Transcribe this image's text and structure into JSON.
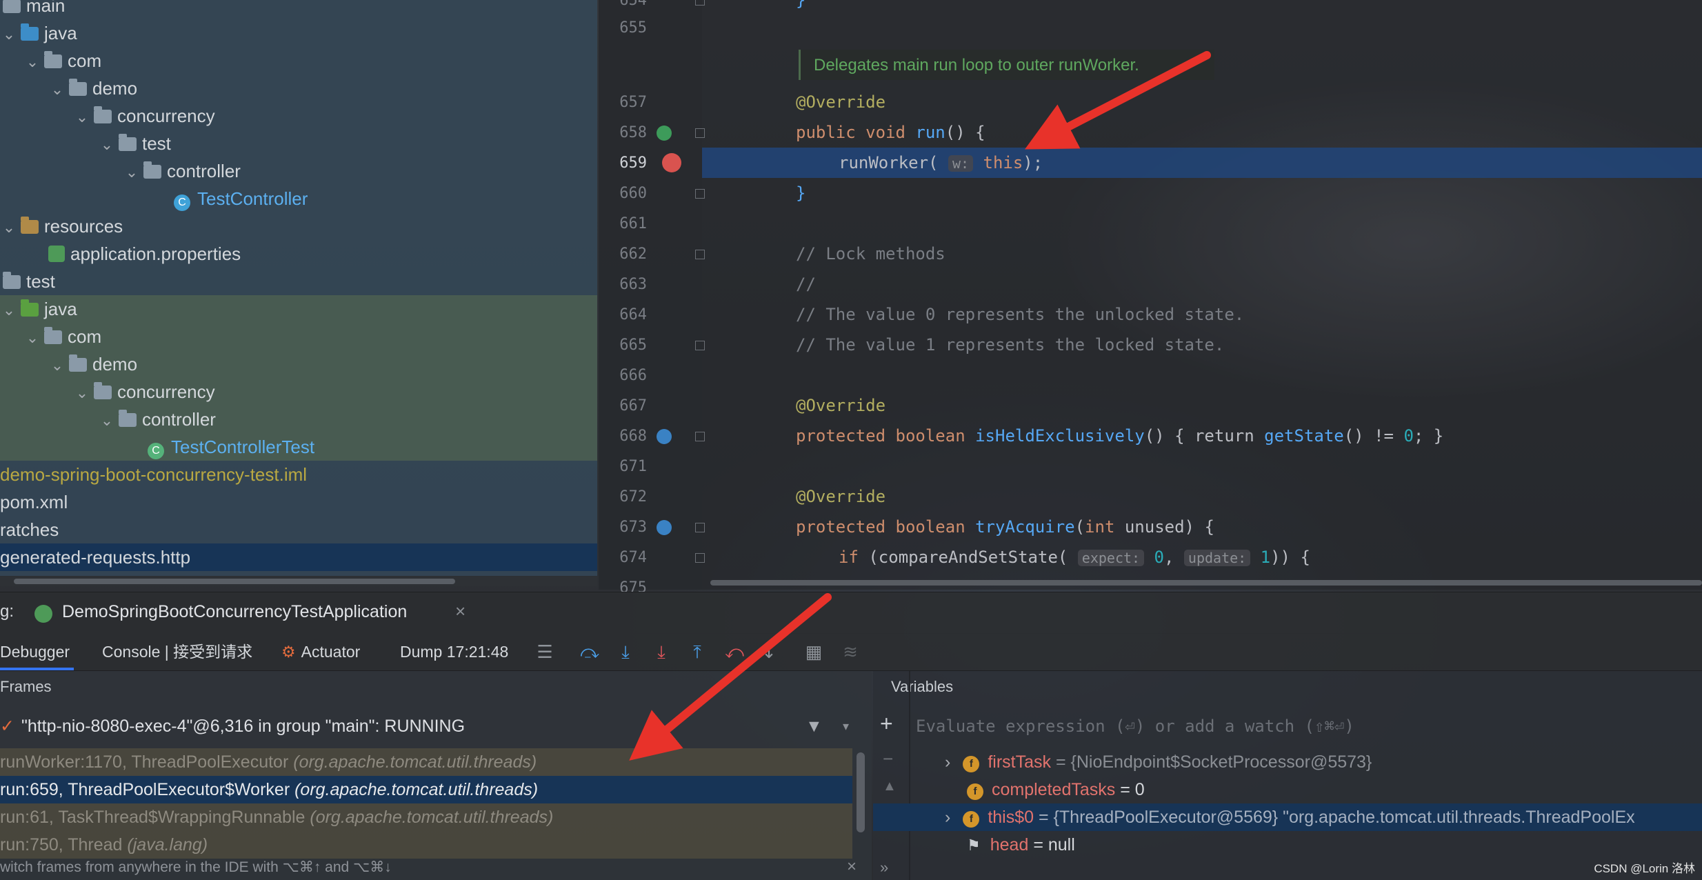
{
  "project_tree": {
    "items": [
      {
        "label": "main",
        "indent": 0,
        "kind": "folder"
      },
      {
        "label": "java",
        "indent": 1,
        "kind": "folder-blue"
      },
      {
        "label": "com",
        "indent": 2,
        "kind": "package"
      },
      {
        "label": "demo",
        "indent": 3,
        "kind": "package"
      },
      {
        "label": "concurrency",
        "indent": 4,
        "kind": "package"
      },
      {
        "label": "test",
        "indent": 5,
        "kind": "package"
      },
      {
        "label": "controller",
        "indent": 6,
        "kind": "package"
      },
      {
        "label": "TestController",
        "indent": 7,
        "kind": "class"
      },
      {
        "label": "resources",
        "indent": 1,
        "kind": "resources"
      },
      {
        "label": "application.properties",
        "indent": 2,
        "kind": "properties"
      },
      {
        "label": "test",
        "indent": 0,
        "kind": "folder"
      },
      {
        "label": "java",
        "indent": 1,
        "kind": "folder-green"
      },
      {
        "label": "com",
        "indent": 2,
        "kind": "package"
      },
      {
        "label": "demo",
        "indent": 3,
        "kind": "package"
      },
      {
        "label": "concurrency",
        "indent": 4,
        "kind": "package"
      },
      {
        "label": "controller",
        "indent": 5,
        "kind": "package"
      },
      {
        "label": "TestControllerTest",
        "indent": 6,
        "kind": "test-class"
      },
      {
        "label": "demo-spring-boot-concurrency-test.iml",
        "indent": 0,
        "kind": "iml"
      },
      {
        "label": "pom.xml",
        "indent": 0,
        "kind": "file"
      },
      {
        "label": "ratches",
        "indent": 0,
        "kind": "file"
      },
      {
        "label": "generated-requests.http",
        "indent": 0,
        "kind": "file-selected"
      }
    ]
  },
  "editor": {
    "line_numbers": [
      "654",
      "655",
      "",
      "657",
      "658",
      "659",
      "660",
      "661",
      "662",
      "663",
      "664",
      "665",
      "666",
      "667",
      "668",
      "671",
      "672",
      "673",
      "674",
      "675"
    ],
    "doc_comment": "Delegates main run loop to outer runWorker.",
    "lines": {
      "l657": "@Override",
      "l658_kw": "public void",
      "l658_fn": "run",
      "l658_rest": "() {",
      "l659_a": "runWorker(",
      "l659_hint": "w:",
      "l659_this": "this",
      "l659_b": ");",
      "l660": "}",
      "l662": "// Lock methods",
      "l663": "//",
      "l664": "// The value 0 represents the unlocked state.",
      "l665": "// The value 1 represents the locked state.",
      "l667": "@Override",
      "l668_kw": "protected boolean",
      "l668_fn": "isHeldExclusively",
      "l668_b": "() { return",
      "l668_c": "getState",
      "l668_d": "() != ",
      "l668_num": "0",
      "l668_e": "; }",
      "l672": "@Override",
      "l673_kw": "protected boolean",
      "l673_fn": "tryAcquire",
      "l673_b": "(",
      "l673_kw2": "int",
      "l673_c": " unused) {",
      "l674_kw": "if",
      "l674_a": " (compareAndSetState(",
      "l674_hint1": "expect:",
      "l674_num1": "0",
      "l674_sep": ", ",
      "l674_hint2": "update:",
      "l674_num2": "1",
      "l674_b": ")) {"
    }
  },
  "debug": {
    "run_prefix": "g:",
    "run_config": "DemoSpringBootConcurrencyTestApplication",
    "tabs": {
      "debugger": "Debugger",
      "console": "Console | 接受到请求",
      "actuator": "Actuator",
      "dump": "Dump 17:21:48"
    },
    "frames_title": "Frames",
    "variables_title": "Variables",
    "thread": "\"http-nio-8080-exec-4\"@6,316 in group \"main\": RUNNING",
    "frames": [
      {
        "method": "runWorker:1170, ThreadPoolExecutor",
        "pkg": "(org.apache.tomcat.util.threads)",
        "state": "dim"
      },
      {
        "method": "run:659, ThreadPoolExecutor$Worker",
        "pkg": "(org.apache.tomcat.util.threads)",
        "state": "selected"
      },
      {
        "method": "run:61, TaskThread$WrappingRunnable",
        "pkg": "(org.apache.tomcat.util.threads)",
        "state": "dim"
      },
      {
        "method": "run:750, Thread",
        "pkg": "(java.lang)",
        "state": "dim"
      }
    ],
    "frames_hint": "witch frames from anywhere in the IDE with ⌥⌘↑ and ⌥⌘↓",
    "eval_placeholder": "Evaluate expression (⏎) or add a watch (⇧⌘⏎)",
    "variables": [
      {
        "name": "firstTask",
        "value": "= {NioEndpoint$SocketProcessor@5573}",
        "expandable": true,
        "badge": "f"
      },
      {
        "name": "completedTasks",
        "value": "= 0",
        "expandable": false,
        "badge": "f"
      },
      {
        "name": "this$0",
        "value": "= {ThreadPoolExecutor@5569} \"org.apache.tomcat.util.threads.ThreadPoolEx",
        "expandable": true,
        "badge": "f",
        "selected": true
      },
      {
        "name": "head",
        "value": "= null",
        "expandable": false,
        "badge": "flag"
      }
    ]
  },
  "watermark": "CSDN @Lorin 洛林",
  "colors": {
    "selection": "#173456",
    "arrow": "#e8322a",
    "keyword": "#cf8e6d",
    "annotation": "#b3ae60",
    "function": "#56a8f5"
  }
}
